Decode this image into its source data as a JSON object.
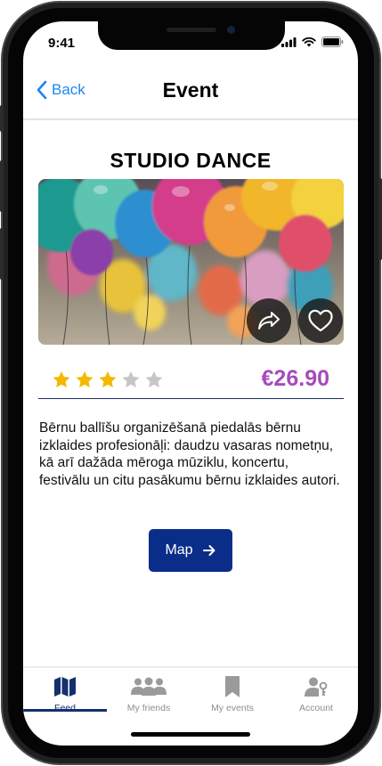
{
  "status_bar": {
    "time": "9:41"
  },
  "nav": {
    "back_label": "Back",
    "title": "Event"
  },
  "event": {
    "name": "STUDIO DANCE",
    "rating": 3,
    "rating_max": 5,
    "price": "€26.90",
    "description": "Bērnu ballīšu organizēšanā piedalās bērnu izklaides profesionāļi: daudzu vasaras nometņu, kā arī dažāda mēroga mūziklu, koncertu, festivālu un citu pasākumu bērnu izklaides autori."
  },
  "actions": {
    "map_label": "Map",
    "share_icon": "share-icon",
    "favorite_icon": "heart-icon"
  },
  "tab_bar": {
    "tabs": [
      {
        "label": "Feed",
        "icon": "map-icon",
        "active": true
      },
      {
        "label": "My friends",
        "icon": "group-icon",
        "active": false
      },
      {
        "label": "My events",
        "icon": "bookmark-icon",
        "active": false
      },
      {
        "label": "Account",
        "icon": "user-key-icon",
        "active": false
      }
    ]
  },
  "colors": {
    "accent_blue": "#1e86f0",
    "primary_navy": "#0b2d8a",
    "price_purple": "#a64bbc",
    "star_gold": "#f5b800",
    "star_empty": "#c6c6c6"
  }
}
